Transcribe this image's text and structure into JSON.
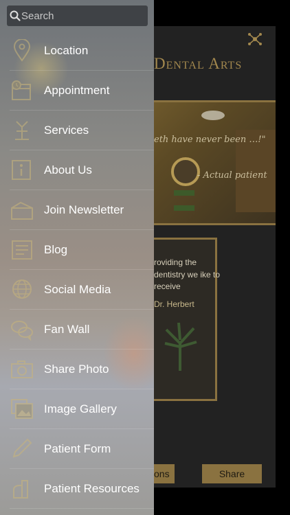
{
  "background_app": {
    "brand_title": "Dental Arts",
    "quote_text": "eth have never been …!\"",
    "quote_author": "- Actual patient",
    "card_text": "roviding the dentistry we ike to receive",
    "card_signature": "Dr. Herbert",
    "left_button_label": "ons",
    "right_button_label": "Share"
  },
  "search": {
    "placeholder": "Search",
    "value": ""
  },
  "menu": [
    {
      "label": "Location",
      "icon": "location-pin-icon"
    },
    {
      "label": "Appointment",
      "icon": "calendar-clock-icon"
    },
    {
      "label": "Services",
      "icon": "services-icon"
    },
    {
      "label": "About Us",
      "icon": "info-icon"
    },
    {
      "label": "Join Newsletter",
      "icon": "mailbox-icon"
    },
    {
      "label": "Blog",
      "icon": "blog-icon"
    },
    {
      "label": "Social Media",
      "icon": "globe-icon"
    },
    {
      "label": "Fan Wall",
      "icon": "chat-bubbles-icon"
    },
    {
      "label": "Share Photo",
      "icon": "camera-icon"
    },
    {
      "label": "Image Gallery",
      "icon": "gallery-icon"
    },
    {
      "label": "Patient Form",
      "icon": "pencil-icon"
    },
    {
      "label": "Patient Resources",
      "icon": "resources-icon"
    }
  ],
  "colors": {
    "accent_gold": "#a3884e",
    "drawer_text": "#ffffff"
  }
}
